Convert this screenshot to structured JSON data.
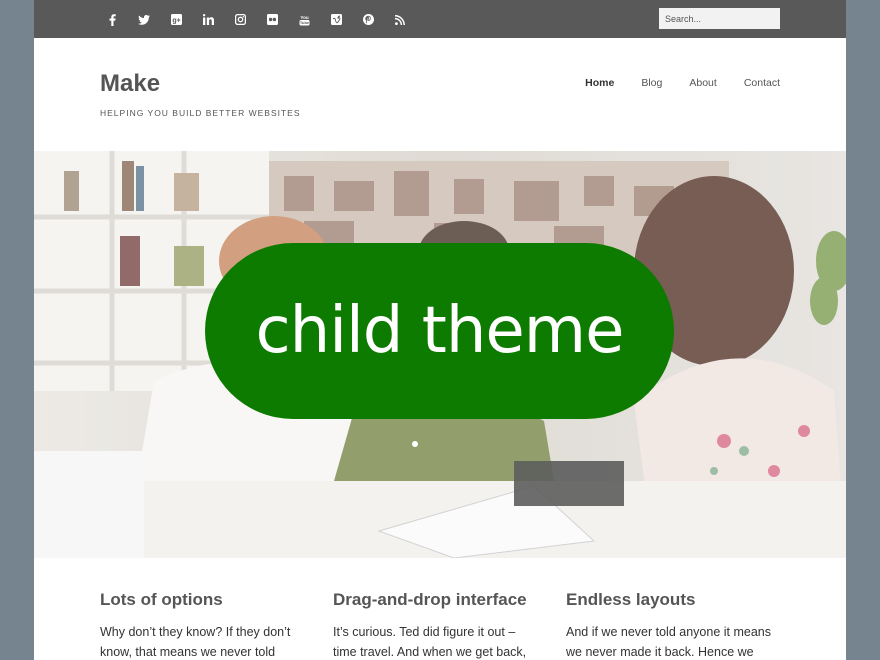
{
  "topbar": {
    "social": [
      {
        "name": "facebook-icon",
        "glyph": "f"
      },
      {
        "name": "twitter-icon",
        "glyph": ""
      },
      {
        "name": "google-plus-icon",
        "glyph": "g+"
      },
      {
        "name": "linkedin-icon",
        "glyph": "in"
      },
      {
        "name": "instagram-icon",
        "glyph": ""
      },
      {
        "name": "flickr-icon",
        "glyph": ""
      },
      {
        "name": "youtube-icon",
        "glyph": ""
      },
      {
        "name": "vimeo-icon",
        "glyph": "v"
      },
      {
        "name": "pinterest-icon",
        "glyph": ""
      },
      {
        "name": "rss-icon",
        "glyph": ""
      }
    ],
    "search_placeholder": "Search..."
  },
  "header": {
    "site_title": "Make",
    "tagline": "Helping you build better websites"
  },
  "nav": {
    "items": [
      "Home",
      "Blog",
      "About",
      "Contact"
    ]
  },
  "hero": {
    "badge_text": "child theme"
  },
  "features": [
    {
      "title": "Lots of options",
      "body": "Why don’t they know? If they don’t know, that means we never told"
    },
    {
      "title": "Drag-and-drop interface",
      "body": "It’s curious. Ted did figure it out – time travel. And when we get back,"
    },
    {
      "title": "Endless layouts",
      "body": "And if we never told anyone it means we never made it back. Hence we die"
    }
  ],
  "colors": {
    "accent_green": "#0d7a00",
    "topbar": "#595959",
    "outer_background": "#76848f"
  }
}
